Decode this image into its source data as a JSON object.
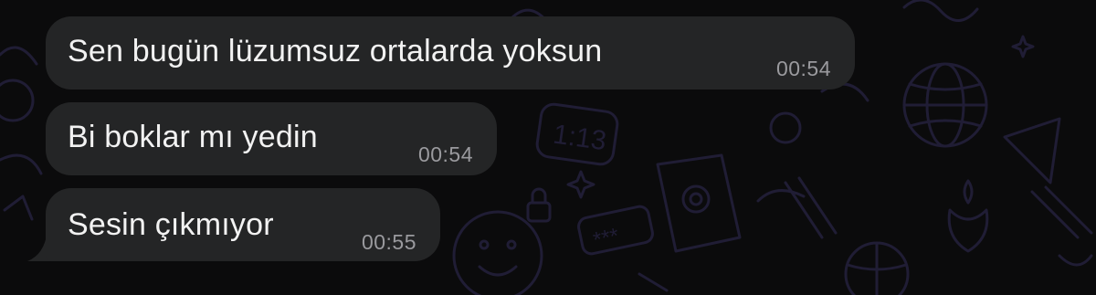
{
  "chat": {
    "messages": [
      {
        "text": "Sen bugün lüzumsuz ortalarda yoksun",
        "time": "00:54"
      },
      {
        "text": "Bi boklar mı yedin",
        "time": "00:54"
      },
      {
        "text": "Sesin çıkmıyor",
        "time": "00:55"
      }
    ]
  },
  "colors": {
    "background": "#0b0b0c",
    "bubble": "#242526",
    "message_text": "#f2f2f2",
    "timestamp_text": "#9a9a9e",
    "wallpaper_doodle": "#1f1c33"
  },
  "wallpaper": {
    "icons": [
      "clock-doodle-icon",
      "globe-doodle-icon",
      "smiley-doodle-icon",
      "spiral-doodle-icon",
      "lock-doodle-icon",
      "password-doodle-icon",
      "basketball-doodle-icon",
      "candle-doodle-icon",
      "star-doodle-icon"
    ],
    "clock_reading": "1:13",
    "password_mask": "***"
  }
}
